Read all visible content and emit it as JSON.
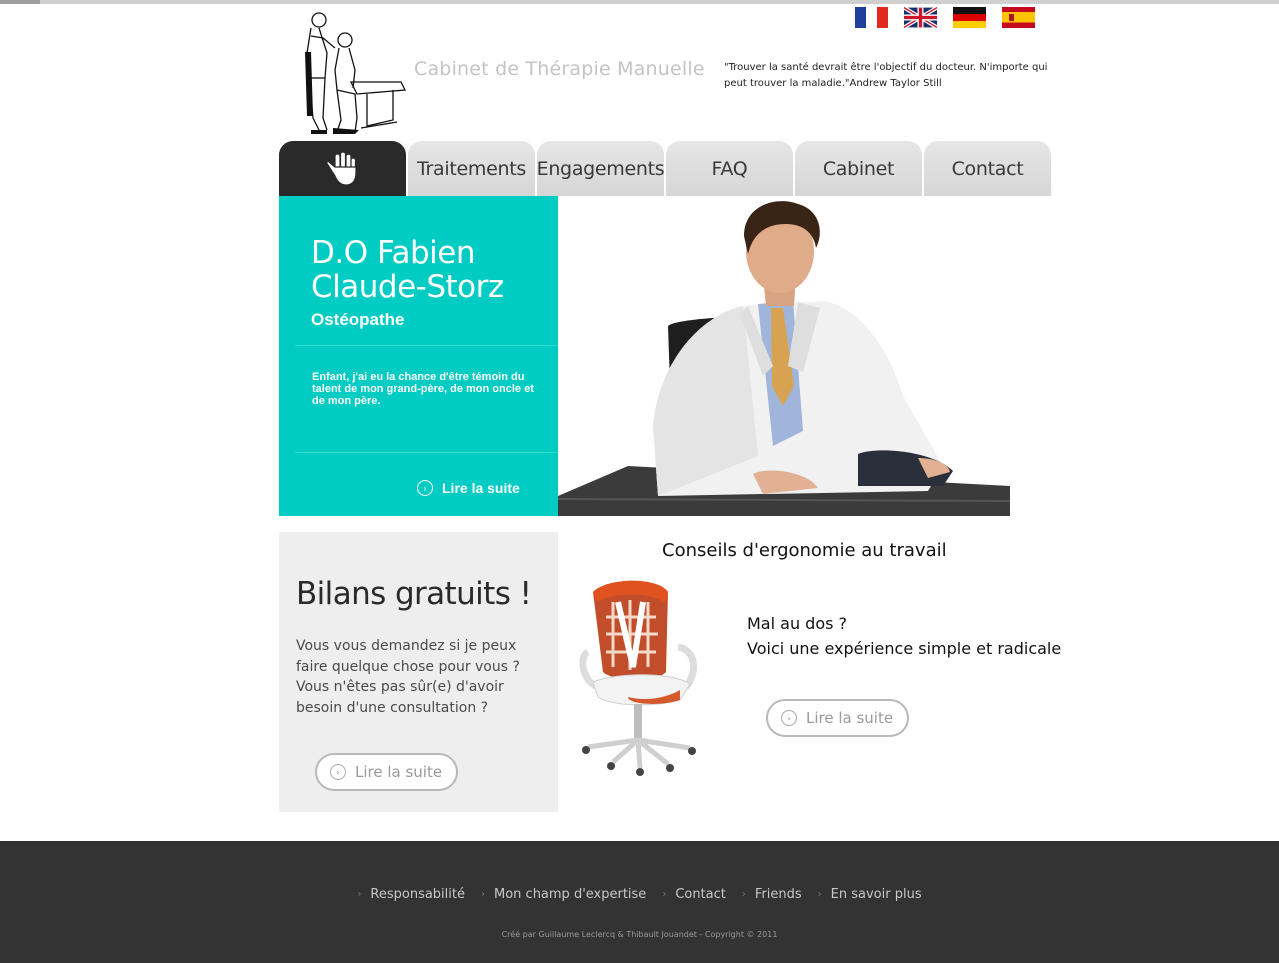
{
  "header": {
    "site_title": "Cabinet de Thérapie Manuelle",
    "quote": "\"Trouver la santé devrait être l'objectif du docteur. N'importe qui peut trouver la maladie.\"Andrew Taylor Still",
    "flags": [
      "flag-france-icon",
      "flag-uk-icon",
      "flag-germany-icon",
      "flag-spain-icon"
    ]
  },
  "nav": {
    "home_icon": "hand-icon",
    "tabs": [
      "Traitements",
      "Engagements",
      "FAQ",
      "Cabinet",
      "Contact"
    ]
  },
  "hero": {
    "name_line1": "D.O Fabien",
    "name_line2": "Claude-Storz",
    "role": "Ostéopathe",
    "text": "Enfant, j'ai eu la chance d'être témoin du talent de mon grand-père, de mon oncle et de mon père.",
    "more_label": "Lire la suite"
  },
  "bilans": {
    "title": "Bilans gratuits !",
    "text": "Vous vous demandez si je peux faire quelque chose pour vous ? Vous n'êtes pas sûr(e) d'avoir besoin d'une consultation ?",
    "more_label": "Lire la suite"
  },
  "ergonomie": {
    "title": "Conseils d'ergonomie au travail",
    "line1": "Mal au dos ?",
    "line2": "Voici une expérience simple et radicale",
    "more_label": "Lire la suite"
  },
  "footer": {
    "links": [
      "Responsabilité",
      "Mon champ d'expertise",
      "Contact",
      "Friends",
      "En savoir plus"
    ],
    "copyright": "Créé par Guillaume Leclercq & Thibault Jouandet - Copyright © 2011"
  },
  "colors": {
    "accent": "#00ccc4",
    "nav_active": "#2a2a2a",
    "footer_bg": "#333333"
  }
}
